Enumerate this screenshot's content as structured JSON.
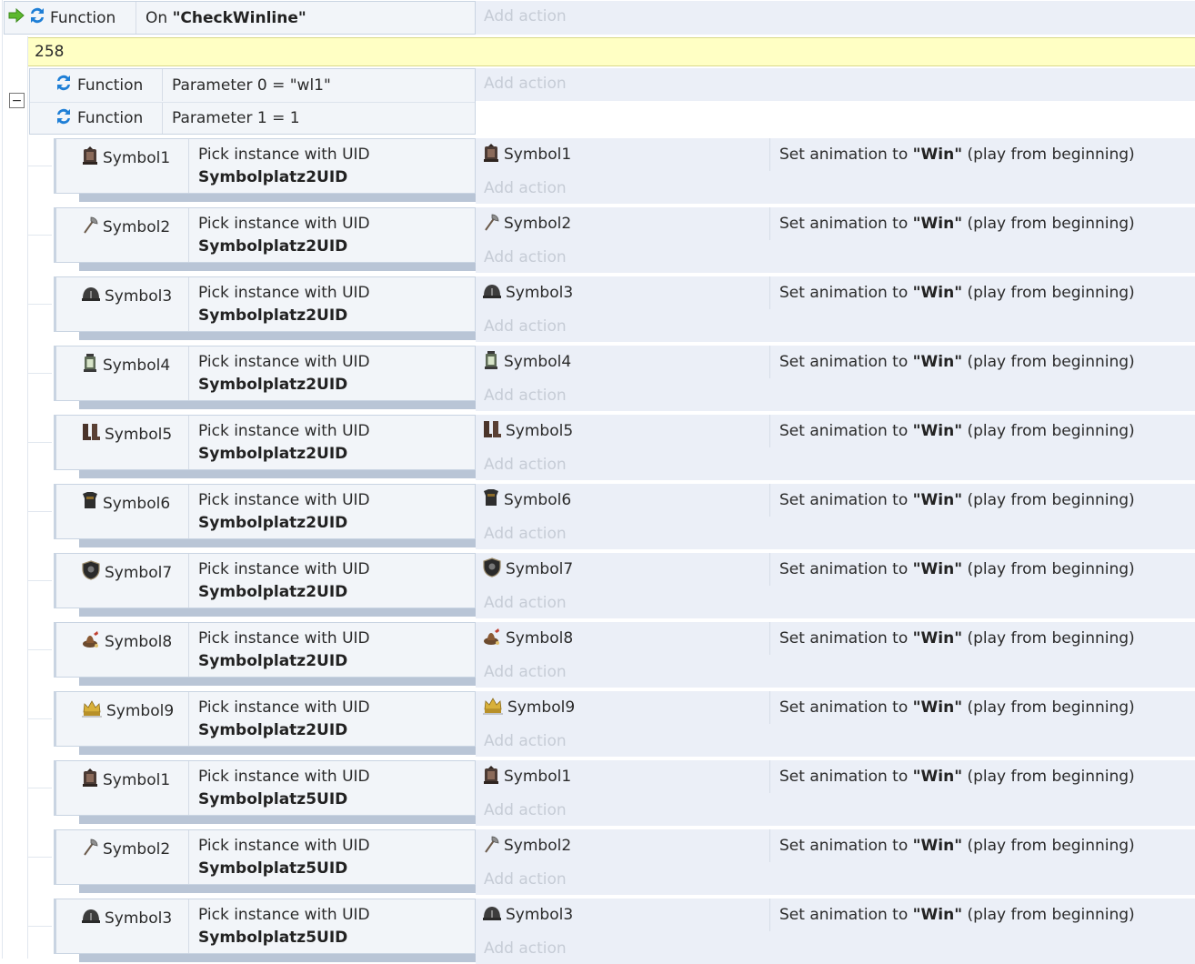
{
  "top_event": {
    "trigger_object": "Function",
    "trigger_prefix": "On ",
    "trigger_name": "\"CheckWinline\"",
    "add_action": "Add action"
  },
  "comment": "258",
  "sub_event": {
    "conditions": [
      {
        "object": "Function",
        "expression": "Parameter 0 = \"wl1\""
      },
      {
        "object": "Function",
        "expression": "Parameter 1 = 1"
      }
    ],
    "add_action": "Add action"
  },
  "collapse_glyph": "−",
  "rows": [
    {
      "symbol": "Symbol1",
      "icon": "lantern-dark-icon",
      "pick_label": "Pick instance with UID",
      "uid": "Symbolplatz2UID",
      "action_object": "Symbol1",
      "action_prefix": "Set animation to ",
      "anim": "\"Win\"",
      "action_suffix": " (play from beginning)",
      "add_action": "Add action"
    },
    {
      "symbol": "Symbol2",
      "icon": "axe-icon",
      "pick_label": "Pick instance with UID",
      "uid": "Symbolplatz2UID",
      "action_object": "Symbol2",
      "action_prefix": "Set animation to ",
      "anim": "\"Win\"",
      "action_suffix": " (play from beginning)",
      "add_action": "Add action"
    },
    {
      "symbol": "Symbol3",
      "icon": "helmet-icon",
      "pick_label": "Pick instance with UID",
      "uid": "Symbolplatz2UID",
      "action_object": "Symbol3",
      "action_prefix": "Set animation to ",
      "anim": "\"Win\"",
      "action_suffix": " (play from beginning)",
      "add_action": "Add action"
    },
    {
      "symbol": "Symbol4",
      "icon": "lantern-green-icon",
      "pick_label": "Pick instance with UID",
      "uid": "Symbolplatz2UID",
      "action_object": "Symbol4",
      "action_prefix": "Set animation to ",
      "anim": "\"Win\"",
      "action_suffix": " (play from beginning)",
      "add_action": "Add action"
    },
    {
      "symbol": "Symbol5",
      "icon": "boots-icon",
      "pick_label": "Pick instance with UID",
      "uid": "Symbolplatz2UID",
      "action_object": "Symbol5",
      "action_prefix": "Set animation to ",
      "anim": "\"Win\"",
      "action_suffix": " (play from beginning)",
      "add_action": "Add action"
    },
    {
      "symbol": "Symbol6",
      "icon": "armor-icon",
      "pick_label": "Pick instance with UID",
      "uid": "Symbolplatz2UID",
      "action_object": "Symbol6",
      "action_prefix": "Set animation to ",
      "anim": "\"Win\"",
      "action_suffix": " (play from beginning)",
      "add_action": "Add action"
    },
    {
      "symbol": "Symbol7",
      "icon": "shield-icon",
      "pick_label": "Pick instance with UID",
      "uid": "Symbolplatz2UID",
      "action_object": "Symbol7",
      "action_prefix": "Set animation to ",
      "anim": "\"Win\"",
      "action_suffix": " (play from beginning)",
      "add_action": "Add action"
    },
    {
      "symbol": "Symbol8",
      "icon": "potion-icon",
      "pick_label": "Pick instance with UID",
      "uid": "Symbolplatz2UID",
      "action_object": "Symbol8",
      "action_prefix": "Set animation to ",
      "anim": "\"Win\"",
      "action_suffix": " (play from beginning)",
      "add_action": "Add action"
    },
    {
      "symbol": "Symbol9",
      "icon": "crown-icon",
      "pick_label": "Pick instance with UID",
      "uid": "Symbolplatz2UID",
      "action_object": "Symbol9",
      "action_prefix": "Set animation to ",
      "anim": "\"Win\"",
      "action_suffix": " (play from beginning)",
      "add_action": "Add action"
    },
    {
      "symbol": "Symbol1",
      "icon": "lantern-dark-icon",
      "pick_label": "Pick instance with UID",
      "uid": "Symbolplatz5UID",
      "action_object": "Symbol1",
      "action_prefix": "Set animation to ",
      "anim": "\"Win\"",
      "action_suffix": " (play from beginning)",
      "add_action": "Add action"
    },
    {
      "symbol": "Symbol2",
      "icon": "axe-icon",
      "pick_label": "Pick instance with UID",
      "uid": "Symbolplatz5UID",
      "action_object": "Symbol2",
      "action_prefix": "Set animation to ",
      "anim": "\"Win\"",
      "action_suffix": " (play from beginning)",
      "add_action": "Add action"
    },
    {
      "symbol": "Symbol3",
      "icon": "helmet-icon",
      "pick_label": "Pick instance with UID",
      "uid": "Symbolplatz5UID",
      "action_object": "Symbol3",
      "action_prefix": "Set animation to ",
      "anim": "\"Win\"",
      "action_suffix": " (play from beginning)",
      "add_action": "Add action"
    }
  ],
  "colors": {
    "comment_bg": "#ffffc4",
    "condition_bg": "#f2f5f9",
    "action_bg": "#ebeff7",
    "add_action_text": "#c6ccd6",
    "function_icon": "#1f7fd6",
    "trigger_arrow": "#5cb82e"
  }
}
